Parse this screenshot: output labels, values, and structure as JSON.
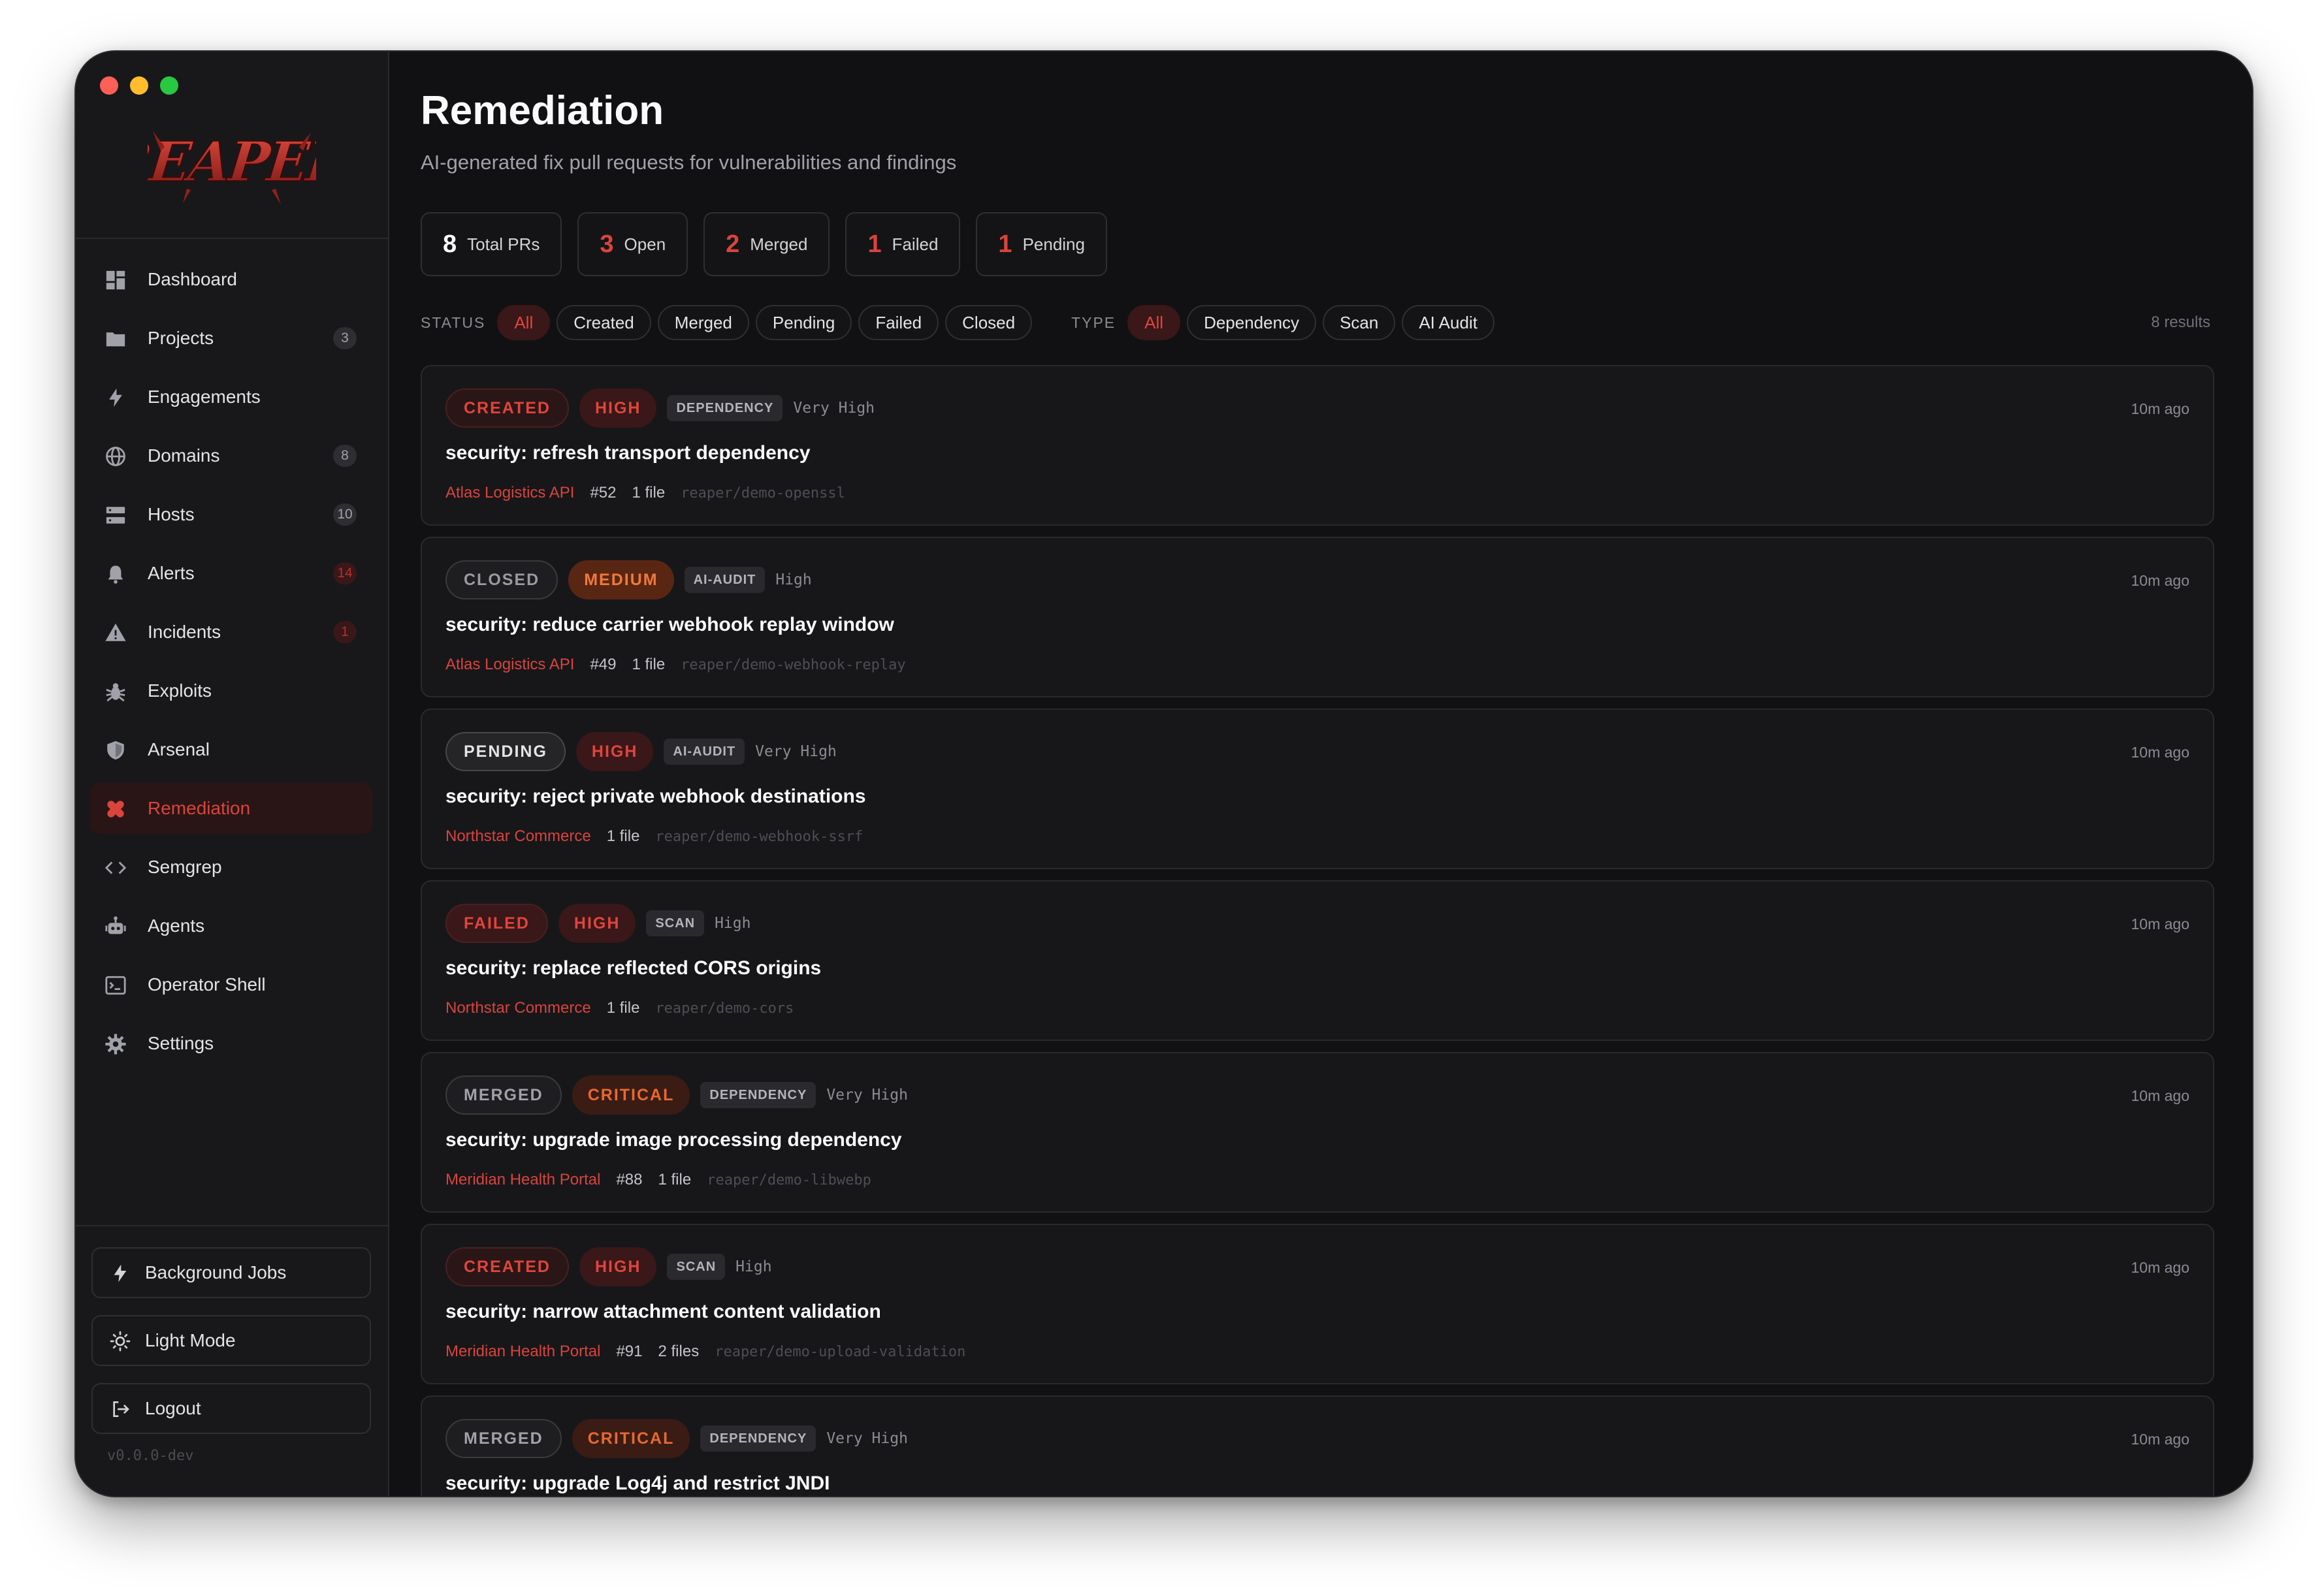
{
  "app": {
    "logo_text": "REAPER",
    "version": "v0.0.0-dev"
  },
  "colors": {
    "accent": "#d9443c",
    "critical": "#e8692f",
    "medium": "#f07a3a",
    "sidebar_bg": "#18181b",
    "main_bg": "#111113"
  },
  "sidebar": {
    "items": [
      {
        "label": "Dashboard",
        "icon": "dashboard-icon",
        "badge": "",
        "active": false
      },
      {
        "label": "Projects",
        "icon": "folder-icon",
        "badge": "3",
        "active": false
      },
      {
        "label": "Engagements",
        "icon": "lightning-icon",
        "badge": "",
        "active": false
      },
      {
        "label": "Domains",
        "icon": "globe-icon",
        "badge": "8",
        "active": false
      },
      {
        "label": "Hosts",
        "icon": "server-icon",
        "badge": "10",
        "active": false
      },
      {
        "label": "Alerts",
        "icon": "bell-icon",
        "badge": "14",
        "badge_style": "red",
        "active": false
      },
      {
        "label": "Incidents",
        "icon": "warning-icon",
        "badge": "1",
        "badge_style": "red",
        "active": false
      },
      {
        "label": "Exploits",
        "icon": "bug-icon",
        "badge": "",
        "active": false
      },
      {
        "label": "Arsenal",
        "icon": "shield-icon",
        "badge": "",
        "active": false
      },
      {
        "label": "Remediation",
        "icon": "bandage-icon",
        "badge": "",
        "active": true
      },
      {
        "label": "Semgrep",
        "icon": "code-icon",
        "badge": "",
        "active": false
      },
      {
        "label": "Agents",
        "icon": "robot-icon",
        "badge": "",
        "active": false
      },
      {
        "label": "Operator Shell",
        "icon": "terminal-icon",
        "badge": "",
        "active": false
      },
      {
        "label": "Settings",
        "icon": "gear-icon",
        "badge": "",
        "active": false
      }
    ],
    "bottom": {
      "background_jobs": "Background Jobs",
      "light_mode": "Light Mode",
      "logout": "Logout"
    }
  },
  "page": {
    "title": "Remediation",
    "subtitle": "AI-generated fix pull requests for vulnerabilities and findings"
  },
  "stats": [
    {
      "value": "8",
      "label": "Total PRs",
      "color": "#fafafa"
    },
    {
      "value": "3",
      "label": "Open",
      "color": "#d9443c"
    },
    {
      "value": "2",
      "label": "Merged",
      "color": "#d9443c"
    },
    {
      "value": "1",
      "label": "Failed",
      "color": "#d9443c"
    },
    {
      "value": "1",
      "label": "Pending",
      "color": "#d9443c"
    }
  ],
  "filters": {
    "status_label": "STATUS",
    "status_options": [
      "All",
      "Created",
      "Merged",
      "Pending",
      "Failed",
      "Closed"
    ],
    "status_selected": "All",
    "type_label": "TYPE",
    "type_options": [
      "All",
      "Dependency",
      "Scan",
      "AI Audit"
    ],
    "type_selected": "All",
    "results": "8 results"
  },
  "prs": [
    {
      "status": "CREATED",
      "severity": "HIGH",
      "type": "DEPENDENCY",
      "confidence": "Very High",
      "ago": "10m ago",
      "title": "security: refresh transport dependency",
      "project": "Atlas Logistics API",
      "number": "#52",
      "files": "1 file",
      "repo": "reaper/demo-openssl"
    },
    {
      "status": "CLOSED",
      "severity": "MEDIUM",
      "type": "AI-AUDIT",
      "confidence": "High",
      "ago": "10m ago",
      "title": "security: reduce carrier webhook replay window",
      "project": "Atlas Logistics API",
      "number": "#49",
      "files": "1 file",
      "repo": "reaper/demo-webhook-replay"
    },
    {
      "status": "PENDING",
      "severity": "HIGH",
      "type": "AI-AUDIT",
      "confidence": "Very High",
      "ago": "10m ago",
      "title": "security: reject private webhook destinations",
      "project": "Northstar Commerce",
      "number": "",
      "files": "1 file",
      "repo": "reaper/demo-webhook-ssrf"
    },
    {
      "status": "FAILED",
      "severity": "HIGH",
      "type": "SCAN",
      "confidence": "High",
      "ago": "10m ago",
      "title": "security: replace reflected CORS origins",
      "project": "Northstar Commerce",
      "number": "",
      "files": "1 file",
      "repo": "reaper/demo-cors"
    },
    {
      "status": "MERGED",
      "severity": "CRITICAL",
      "type": "DEPENDENCY",
      "confidence": "Very High",
      "ago": "10m ago",
      "title": "security: upgrade image processing dependency",
      "project": "Meridian Health Portal",
      "number": "#88",
      "files": "1 file",
      "repo": "reaper/demo-libwebp"
    },
    {
      "status": "CREATED",
      "severity": "HIGH",
      "type": "SCAN",
      "confidence": "High",
      "ago": "10m ago",
      "title": "security: narrow attachment content validation",
      "project": "Meridian Health Portal",
      "number": "#91",
      "files": "2 files",
      "repo": "reaper/demo-upload-validation"
    },
    {
      "status": "MERGED",
      "severity": "CRITICAL",
      "type": "DEPENDENCY",
      "confidence": "Very High",
      "ago": "10m ago",
      "title": "security: upgrade Log4j and restrict JNDI",
      "project": "",
      "number": "",
      "files": "",
      "repo": ""
    }
  ]
}
